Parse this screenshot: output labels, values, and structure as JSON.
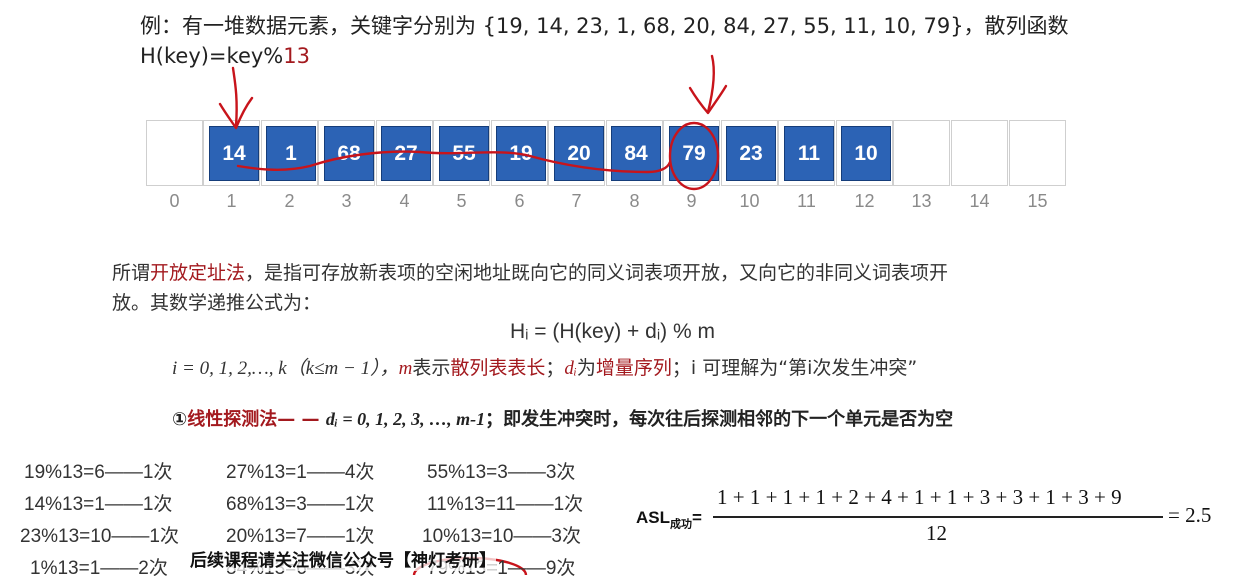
{
  "intro": {
    "line1_prefix": "例：有一堆数据元素，关键字分别为 {19, 14, 23, 1, 68, 20, 84, 27, 55, 11, 10, 79}，散列函数",
    "line2_prefix": "H(key)=key%",
    "line2_mod": "13"
  },
  "table": {
    "values": [
      "",
      "14",
      "1",
      "68",
      "27",
      "55",
      "19",
      "20",
      "84",
      "79",
      "23",
      "11",
      "10",
      "",
      "",
      ""
    ],
    "indices": [
      "0",
      "1",
      "2",
      "3",
      "4",
      "5",
      "6",
      "7",
      "8",
      "9",
      "10",
      "11",
      "12",
      "13",
      "14",
      "15"
    ]
  },
  "definition": {
    "intro": "所谓",
    "term": "开放定址法",
    "rest1": "，是指可存放新表项的空闲地址既向它的同义词表项开放，又向它的非同义词表项开",
    "rest2": "放。其数学递推公式为：",
    "formula": "Hᵢ = (H(key) + dᵢ) % m",
    "cond_i": "i = 0, 1, 2,…, k（k≤m − 1），",
    "cond_m": "m",
    "cond_m_text": "表示",
    "cond_m_term": "散列表表长",
    "cond_sep": "；",
    "cond_d": "dᵢ",
    "cond_d_text": "为",
    "cond_d_term": "增量序列",
    "cond_end": "；i 可理解为“第i次发生冲突”"
  },
  "linear_probe": {
    "num": "①",
    "term": "线性探测法",
    "dash": "— —",
    "seq": "dᵢ = 0, 1, 2, 3, …, m-1",
    "desc": "；即发生冲突时，每次往后探测相邻的下一个单元是否为空"
  },
  "calcs": [
    [
      "19%13=6——1次",
      "27%13=1——4次",
      "55%13=3——3次"
    ],
    [
      "14%13=1——1次",
      "68%13=3——1次",
      "11%13=11——1次"
    ],
    [
      "23%13=10——1次",
      "20%13=7——1次",
      "10%13=10——3次"
    ],
    [
      "1%13=1——2次",
      "84%13=6——3次",
      "79%13=1——9次"
    ]
  ],
  "asl": {
    "label": "ASL",
    "sub": "成功",
    "eq": "=",
    "numerator": "1 + 1 + 1 + 1 + 2 + 4 + 1 + 1 + 3 + 3 + 1 + 3 + 9",
    "denominator": "12",
    "result": "= 2.5"
  },
  "overlay": {
    "text": "后续课程请关注微信公众号【神灯考研】"
  }
}
